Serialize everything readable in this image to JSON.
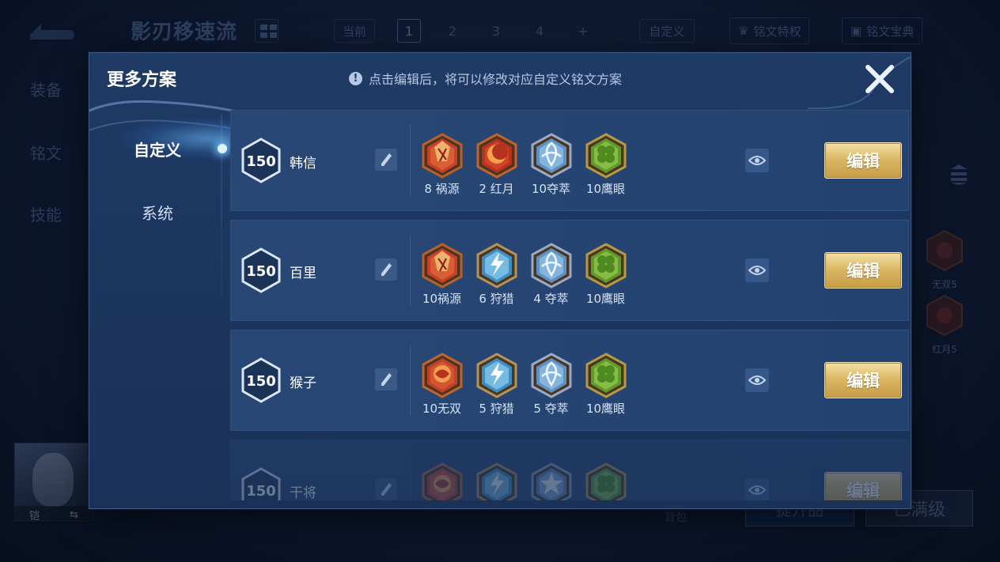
{
  "background": {
    "title": "影刃移速流",
    "tabs": {
      "current": "当前",
      "pages": [
        "1",
        "2",
        "3",
        "4",
        "+"
      ],
      "active_page": "1"
    },
    "custom_btn": "自定义",
    "privilege_btn": "铭文特权",
    "codex_btn": "铭文宝典",
    "left_nav": [
      "装备",
      "铭文",
      "技能"
    ],
    "side_runes": [
      {
        "label": "无双5"
      },
      {
        "label": "红月5"
      }
    ],
    "hero": {
      "name": "铠",
      "swap": "⇆"
    },
    "bag": "背包",
    "upgrade_btn": "提升品",
    "maxed_btn": "已满级"
  },
  "modal": {
    "title": "更多方案",
    "hint": "点击编辑后，将可以修改对应自定义铭文方案",
    "hint_icon": "!",
    "close_icon": "close-icon",
    "tabs": [
      {
        "label": "自定义",
        "active": true
      },
      {
        "label": "系统",
        "active": false
      }
    ],
    "edit_label": "编辑",
    "rows": [
      {
        "level": "150",
        "hero": "韩信",
        "runes": [
          {
            "name": "8 祸源",
            "kind": "red-shard"
          },
          {
            "name": "2 红月",
            "kind": "red-moon"
          },
          {
            "name": "10夺萃",
            "kind": "blue-knot"
          },
          {
            "name": "10鹰眼",
            "kind": "green-clover"
          }
        ]
      },
      {
        "level": "150",
        "hero": "百里",
        "runes": [
          {
            "name": "10祸源",
            "kind": "red-shard"
          },
          {
            "name": "6 狩猎",
            "kind": "blue-bolt"
          },
          {
            "name": "4 夺萃",
            "kind": "blue-knot"
          },
          {
            "name": "10鹰眼",
            "kind": "green-clover"
          }
        ]
      },
      {
        "level": "150",
        "hero": "猴子",
        "runes": [
          {
            "name": "10无双",
            "kind": "red-rose"
          },
          {
            "name": "5 狩猎",
            "kind": "blue-bolt"
          },
          {
            "name": "5 夺萃",
            "kind": "blue-knot"
          },
          {
            "name": "10鹰眼",
            "kind": "green-clover"
          }
        ]
      },
      {
        "level": "150",
        "hero": "干将",
        "runes": [
          {
            "name": "",
            "kind": "red-rose"
          },
          {
            "name": "",
            "kind": "blue-bolt"
          },
          {
            "name": "",
            "kind": "blue-star"
          },
          {
            "name": "",
            "kind": "green-clover"
          }
        ]
      }
    ]
  },
  "colors": {
    "modal_bg": "#1f3a64",
    "row_bg": "#284774",
    "edit_gold": "#dbb865",
    "accent_glow": "#6fc0ff"
  }
}
